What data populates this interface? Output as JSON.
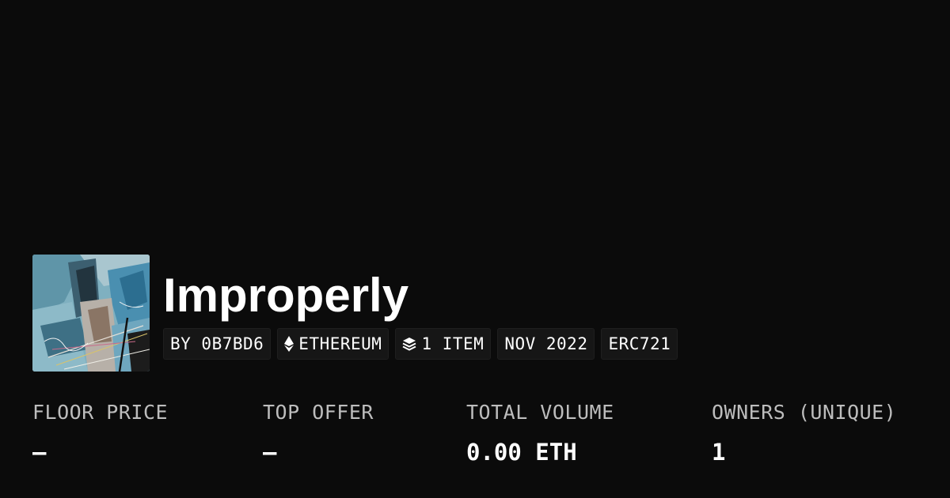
{
  "collection": {
    "name": "Improperly",
    "thumbnail_icon": "collection-artwork-thumbnail"
  },
  "chips": [
    {
      "label": "BY 0B7BD6",
      "icon": null
    },
    {
      "label": "ETHEREUM",
      "icon": "ethereum-icon"
    },
    {
      "label": "1 ITEM",
      "icon": "layers-icon"
    },
    {
      "label": "NOV 2022",
      "icon": null
    },
    {
      "label": "ERC721",
      "icon": null
    }
  ],
  "stats": [
    {
      "label": "FLOOR PRICE",
      "value": "–"
    },
    {
      "label": "TOP OFFER",
      "value": "–"
    },
    {
      "label": "TOTAL VOLUME",
      "value": "0.00 ETH"
    },
    {
      "label": "OWNERS (UNIQUE)",
      "value": "1"
    }
  ],
  "colors": {
    "background": "#0b0b0b",
    "chip_background": "#161616",
    "label_gray": "#bdbdbd",
    "text": "#ffffff"
  }
}
